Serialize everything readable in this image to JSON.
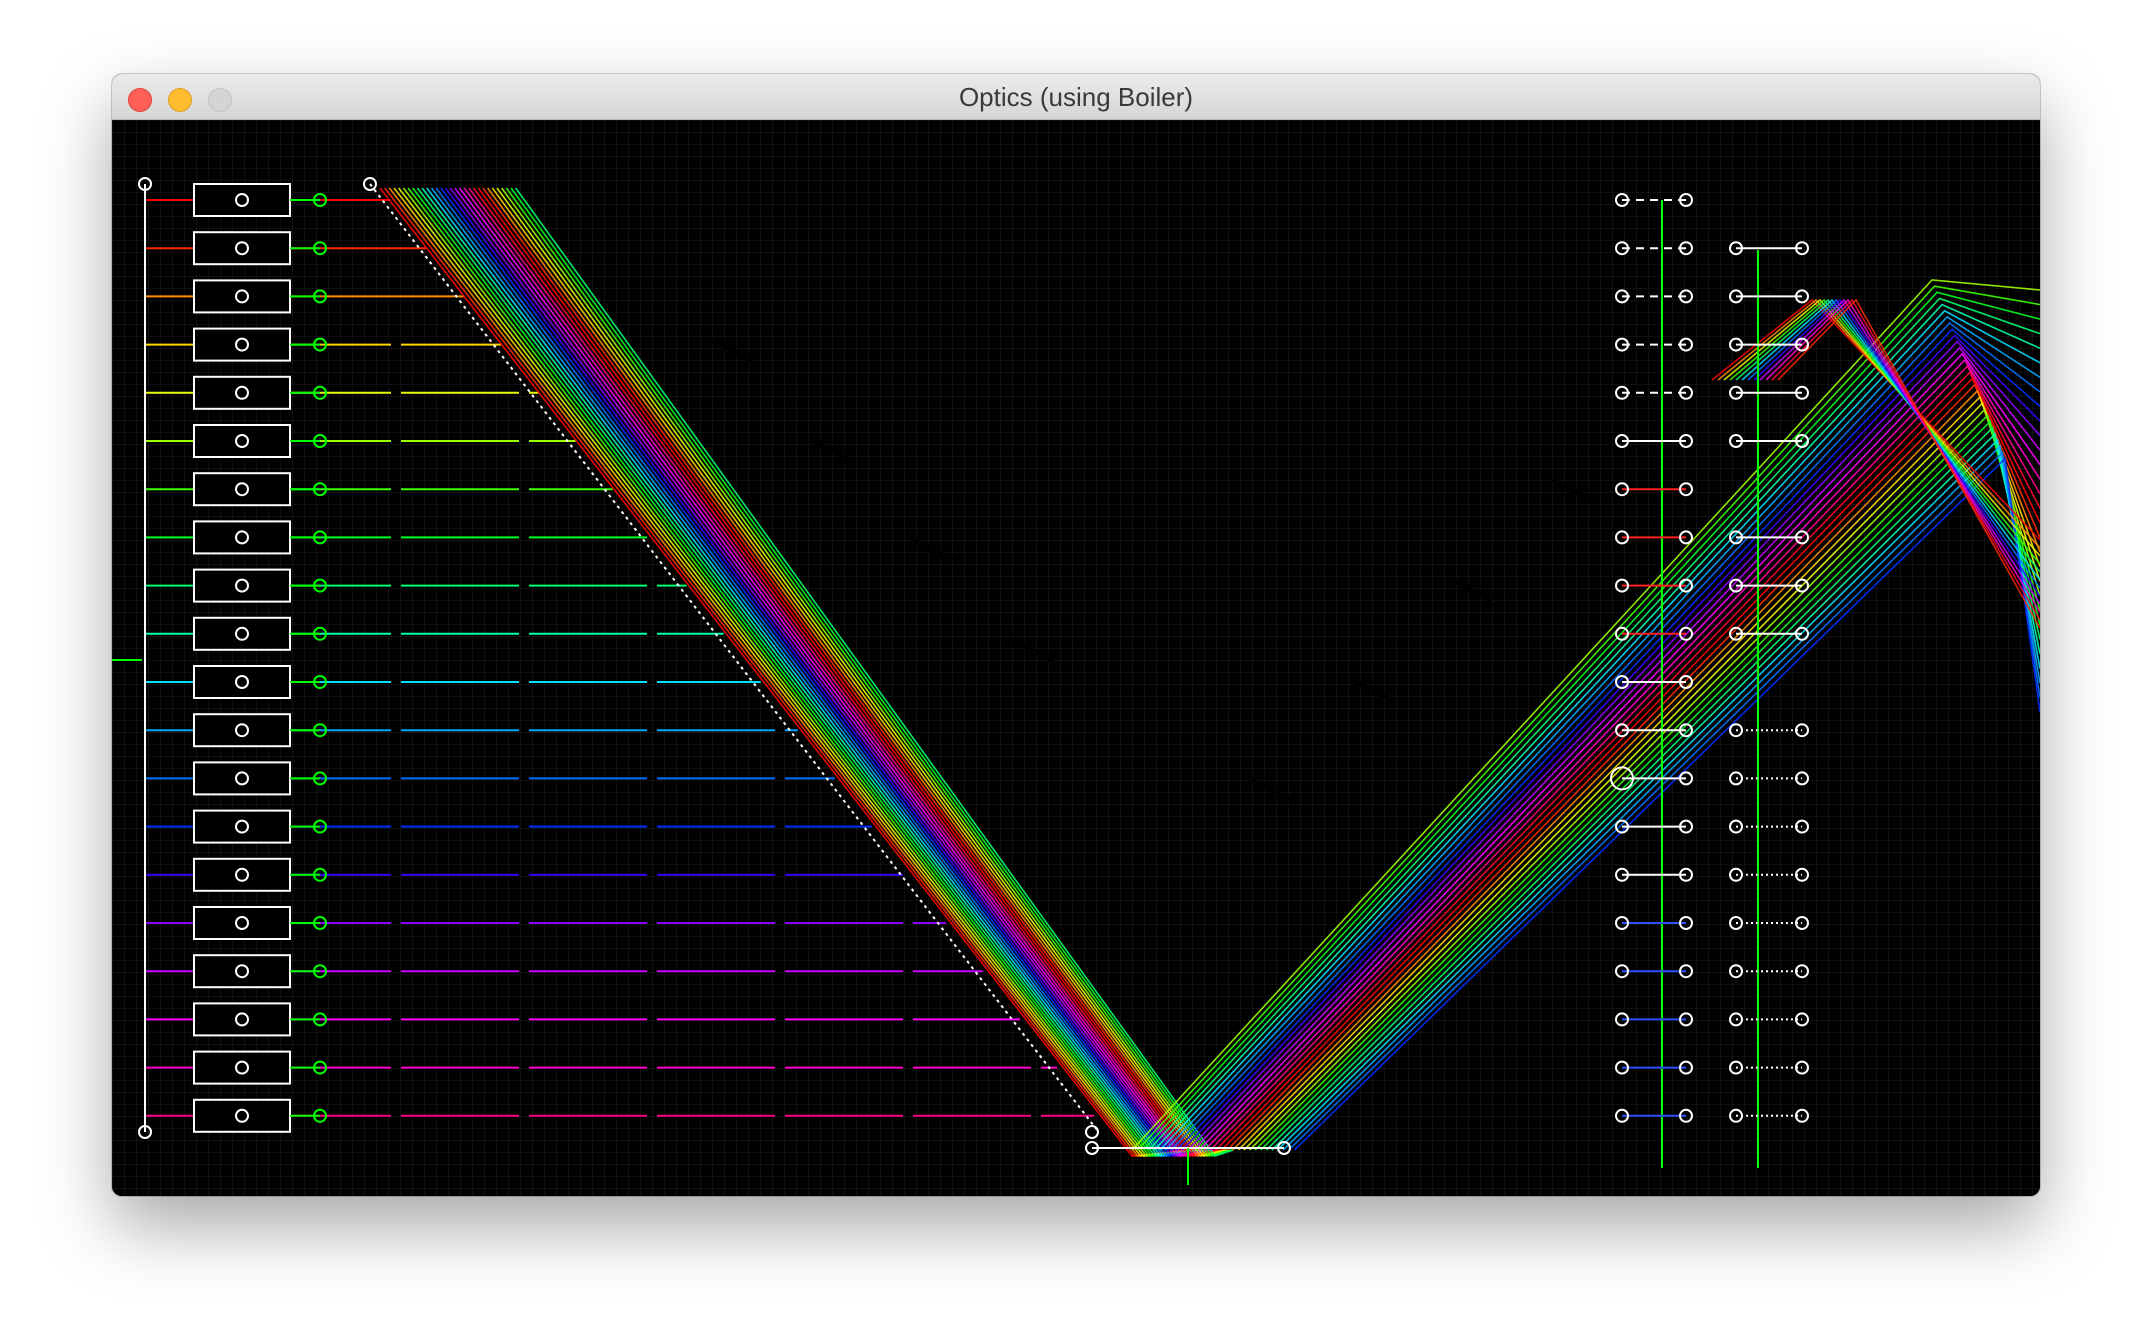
{
  "window": {
    "title": "Optics (using Boiler)",
    "buttons": [
      "close",
      "minimize",
      "zoom"
    ]
  },
  "scene": {
    "background": "#000000",
    "grid_color": "#1e1e1e",
    "component_color": "#ffffff",
    "handle_color": "#00ff00",
    "beam_colors": [
      "#ff0000",
      "#ff2a00",
      "#ff8c00",
      "#ffd800",
      "#e6ff00",
      "#9cff00",
      "#3aff00",
      "#00ff20",
      "#00ff70",
      "#00ffb0",
      "#00e0ff",
      "#00a8ff",
      "#0070ff",
      "#0030ff",
      "#3a00ff",
      "#8a00ff",
      "#c800ff",
      "#ff00ff",
      "#ff00c8",
      "#ff0088",
      "#ff0030"
    ],
    "source_count": 20,
    "detector_rows": 20,
    "icons": [
      "source-block-icon",
      "lens-handle-icon",
      "mirror-handle-icon",
      "detector-pin-icon"
    ]
  }
}
